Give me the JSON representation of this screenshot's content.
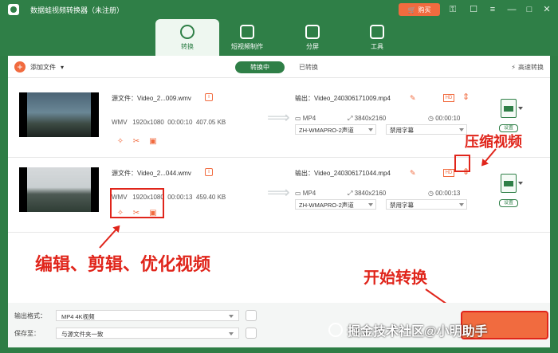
{
  "app": {
    "title": "数据蛙视频转换器（未注册）",
    "buy_label": "购买"
  },
  "main_tabs": [
    {
      "label": "转换"
    },
    {
      "label": "短视频制作"
    },
    {
      "label": "分屏"
    },
    {
      "label": "工具"
    }
  ],
  "toolbar": {
    "add_file_label": "添加文件",
    "subtab_converting": "转换中",
    "subtab_converted": "已转换",
    "high_speed_label": "高速转换"
  },
  "files": [
    {
      "source_name": "源文件：Video_2...009.wmv",
      "src_format": "WMV",
      "src_resolution": "1920x1080",
      "src_duration": "00:00:10",
      "src_size": "407.05 KB",
      "output_name": "输出：Video_240306171009.mp4",
      "out_format": "MP4",
      "out_resolution": "3840x2160",
      "out_duration": "00:00:10",
      "audio_select": "ZH-WMAPRO-2声道",
      "subtitle_select": "禁用字幕",
      "settings_label": "设置"
    },
    {
      "source_name": "源文件：Video_2...044.wmv",
      "src_format": "WMV",
      "src_resolution": "1920x1080",
      "src_duration": "00:00:13",
      "src_size": "459.40 KB",
      "output_name": "输出：Video_240306171044.mp4",
      "out_format": "MP4",
      "out_resolution": "3840x2160",
      "out_duration": "00:00:13",
      "audio_select": "ZH-WMAPRO-2声道",
      "subtitle_select": "禁用字幕",
      "settings_label": "设置"
    }
  ],
  "bottom": {
    "output_format_label": "输出格式：",
    "output_format_value": "MP4 4K视频",
    "save_to_label": "保存至：",
    "save_to_value": "与源文件夹一致"
  },
  "annotations": {
    "compress": "压缩视频",
    "edit_trim_optimize": "编辑、剪辑、优化视频",
    "start": "开始转换"
  },
  "watermark": {
    "text": "掘金技术社区@小明助手"
  },
  "colors": {
    "title_bg": "#2f7f47",
    "accent_orange": "#f16b3f",
    "annotation_red": "#e0251b"
  }
}
